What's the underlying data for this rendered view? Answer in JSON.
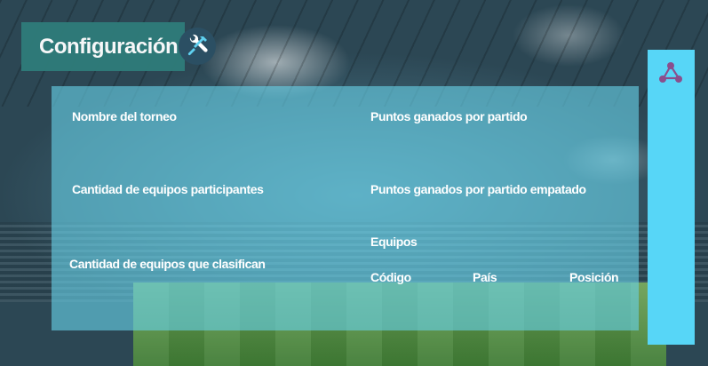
{
  "header": {
    "title": "Configuración",
    "settings_icon": "tools-icon"
  },
  "form": {
    "tournament_name_label": "Nombre del torneo",
    "participants_label": "Cantidad de equipos participantes",
    "qualifiers_label": "Cantidad de equipos que clasifican",
    "points_win_label": "Puntos ganados por partido",
    "points_draw_label": "Puntos ganados por partido empatado",
    "teams_label": "Equipos",
    "teams_columns": [
      "Código",
      "País",
      "Posición"
    ]
  },
  "sidebar": {
    "icon": "share-network-icon",
    "color": "#57d6f7"
  },
  "colors": {
    "title_bg": "#2f7c7a",
    "panel_bg": "#68d0e6"
  }
}
